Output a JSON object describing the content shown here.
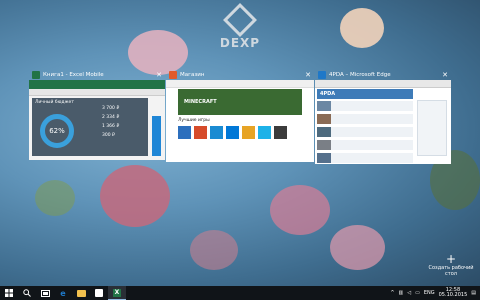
{
  "wallpaper": {
    "brand": "DEXP"
  },
  "windows": [
    {
      "title": "Книга1 - Excel Mobile",
      "icon": "excel-icon",
      "color": "#217346",
      "sheet_label": "Личный бюджет",
      "percent": "62%",
      "values": [
        "3 700 ₽",
        "2 334 ₽",
        "1 366 ₽",
        "300 ₽"
      ]
    },
    {
      "title": "Магазин",
      "icon": "store-icon",
      "color": "#2b2b2b",
      "banner": "MINECRAFT",
      "section": "Лучшие игры"
    },
    {
      "title": "4PDA – Microsoft Edge",
      "icon": "edge-icon",
      "color": "#1e78c8",
      "header": "4PDA"
    }
  ],
  "new_desktop": {
    "label": "Создать рабочий стол",
    "icon": "plus-icon"
  },
  "taskbar": {
    "icons": [
      "windows-icon",
      "search-icon",
      "task-view-icon",
      "edge-icon",
      "explorer-icon",
      "store-icon",
      "excel-icon"
    ],
    "lang": "ENG",
    "time": "12:58",
    "date": "05.10.2015"
  }
}
